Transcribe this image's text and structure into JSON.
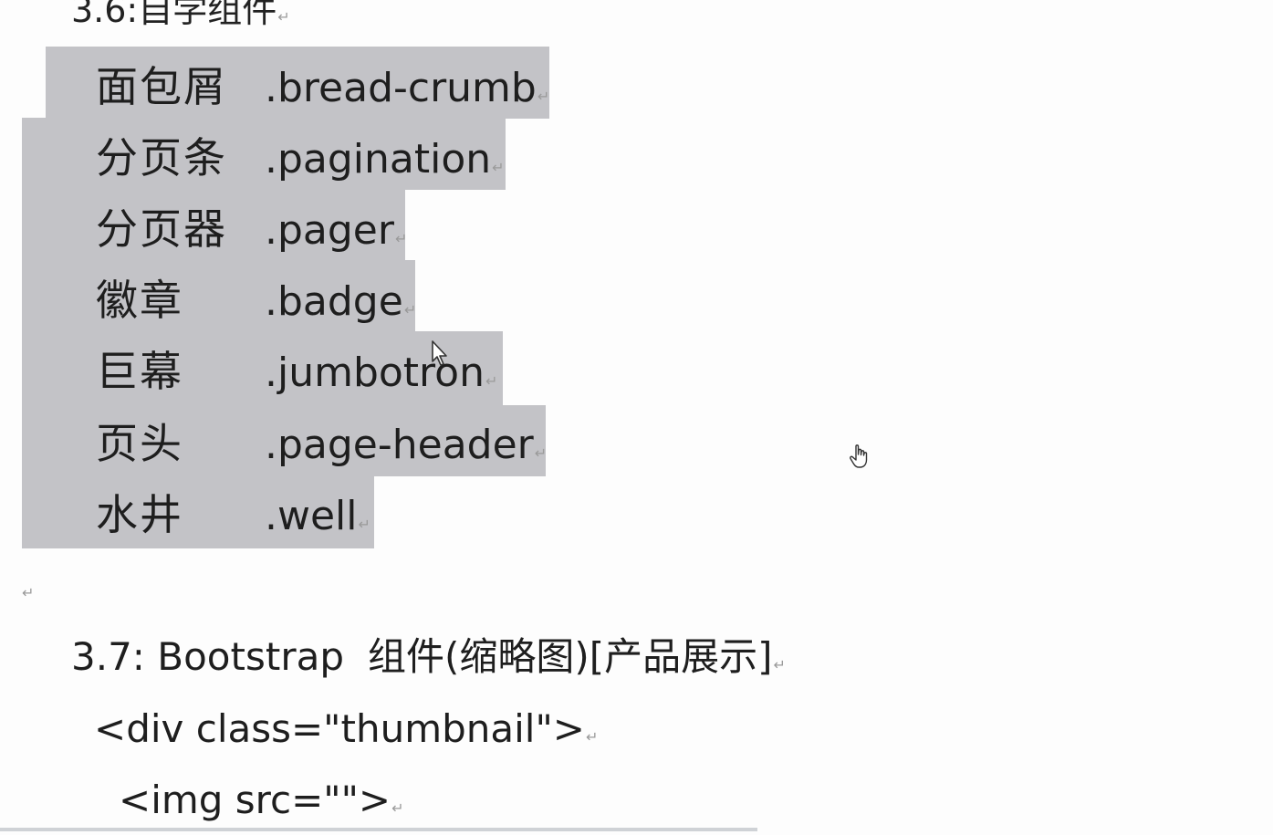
{
  "heading_partial": "3.6:自学组件",
  "paragraph_mark": "↵",
  "components": [
    {
      "zh": "面包屑",
      "cls": ".bread-crumb"
    },
    {
      "zh": "分页条",
      "cls": ".pagination"
    },
    {
      "zh": "分页器",
      "cls": ".pager"
    },
    {
      "zh": "徽章",
      "cls": ".badge"
    },
    {
      "zh": "巨幕",
      "cls": ".jumbotron"
    },
    {
      "zh": "页头",
      "cls": ".page-header"
    },
    {
      "zh": "水井",
      "cls": ".well"
    }
  ],
  "section": {
    "number": "3.7: Bootstrap",
    "title_zh": "组件(缩略图)[产品展示]"
  },
  "code": {
    "line1": "<div class=\"thumbnail\">",
    "line2": "<img src=\"\">"
  },
  "colors": {
    "highlight": "#c3c3c7",
    "text": "#1e1e1e",
    "background": "#fdfdfd"
  },
  "icons": {
    "mouse_pointer": "arrow-cursor-icon",
    "hand_pointer": "hand-cursor-icon"
  }
}
